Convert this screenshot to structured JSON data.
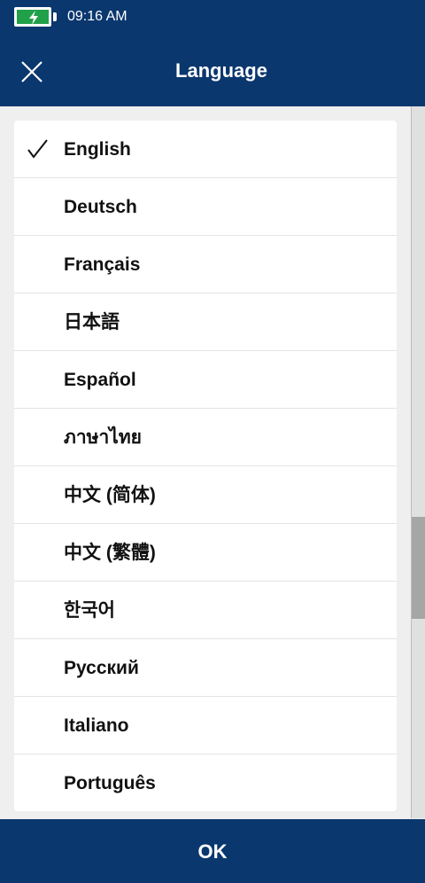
{
  "status_bar": {
    "time": "09:16 AM",
    "battery_icon": "battery-charging-icon",
    "battery_color": "#21a04a"
  },
  "header": {
    "title": "Language",
    "close_icon": "close-icon",
    "background": "#0a376e"
  },
  "languages": {
    "selected": "English",
    "items": [
      {
        "label": "English",
        "selected": true
      },
      {
        "label": "Deutsch",
        "selected": false
      },
      {
        "label": "Français",
        "selected": false
      },
      {
        "label": "日本語",
        "selected": false
      },
      {
        "label": "Español",
        "selected": false
      },
      {
        "label": "ภาษาไทย",
        "selected": false
      },
      {
        "label": "中文 (简体)",
        "selected": false
      },
      {
        "label": "中文 (繁體)",
        "selected": false
      },
      {
        "label": "한국어",
        "selected": false
      },
      {
        "label": "Русский",
        "selected": false
      },
      {
        "label": "Italiano",
        "selected": false
      },
      {
        "label": "Português",
        "selected": false
      }
    ]
  },
  "footer": {
    "ok_label": "OK"
  }
}
